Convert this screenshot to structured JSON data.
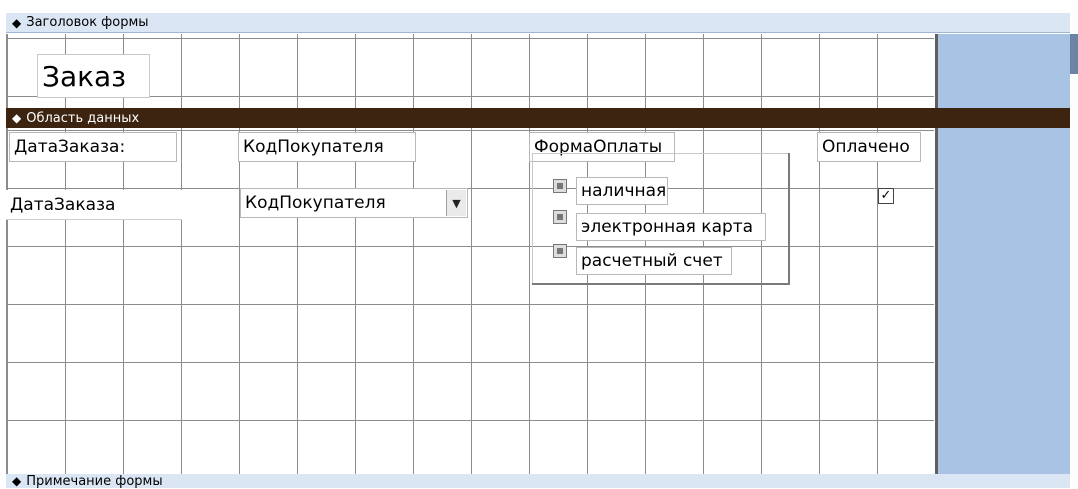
{
  "sections": {
    "header_label": "Заголовок формы",
    "detail_label": "Область данных",
    "footer_label": "Примечание формы"
  },
  "form": {
    "title": "Заказ",
    "labels": {
      "order_date": "ДатаЗаказа:",
      "customer_code": "КодПокупателя",
      "payment_method": "ФормаОплаты",
      "paid": "Оплачено"
    },
    "fields": {
      "order_date": "ДатаЗаказа",
      "customer_code": "КодПокупателя",
      "paid_checked": true
    },
    "payment_options": [
      "наличная",
      "электронная карта",
      "расчетный счет"
    ]
  },
  "icons": {
    "section_marker": "section-arrow-icon",
    "combo_arrow": "chevron-down-icon",
    "checkbox_mark": "check-icon"
  },
  "colors": {
    "detail_bar": "#3d2410",
    "section_bar": "#dbe6f5",
    "side_pane": "#a9c3e4"
  }
}
